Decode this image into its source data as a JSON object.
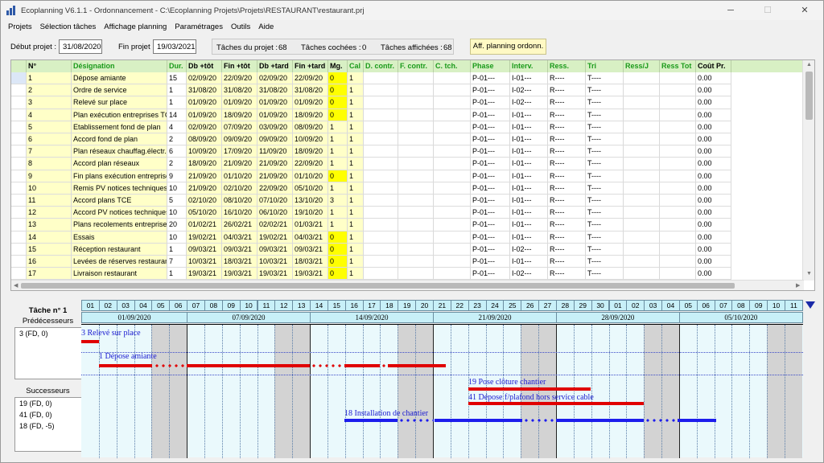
{
  "window": {
    "title": "Ecoplanning V6.1.1 - Ordonnancement - C:\\Ecoplanning Projets\\Projets\\RESTAURANT\\restaurant.prj",
    "minimize": "─",
    "maximize": "☐",
    "close": "✕"
  },
  "menu": [
    "Projets",
    "Sélection tâches",
    "Affichage planning",
    "Paramétrages",
    "Outils",
    "Aide"
  ],
  "info": {
    "debut_label": "Début projet :",
    "debut_value": "31/08/2020",
    "fin_label": "Fin projet :",
    "fin_value": "19/03/2021",
    "taches_projet_label": "Tâches du projet :",
    "taches_projet_value": "68",
    "taches_cochees_label": "Tâches cochées :",
    "taches_cochees_value": "0",
    "taches_affichees_label": "Tâches affichées :",
    "taches_affichees_value": "68",
    "planning_button": "Aff. planning ordonn."
  },
  "table": {
    "headers": [
      "N°",
      "Désignation",
      "Dur.",
      "Db +tôt",
      "Fin +tôt",
      "Db +tard",
      "Fin +tard",
      "Mg.",
      "Cal",
      "D. contr.",
      "F. contr.",
      "C. tch.",
      "Phase",
      "Interv.",
      "Ress.",
      "Tri",
      "Ress/J",
      "Ress Tot",
      "Coût Pr."
    ],
    "rows": [
      [
        "1",
        "Dépose amiante",
        "15",
        "02/09/20",
        "22/09/20",
        "02/09/20",
        "22/09/20",
        "0",
        "1",
        "",
        "",
        "",
        "P-01---",
        "I-01---",
        "R----",
        "T----",
        "",
        "",
        "0.00"
      ],
      [
        "2",
        "Ordre de service",
        "1",
        "31/08/20",
        "31/08/20",
        "31/08/20",
        "31/08/20",
        "0",
        "1",
        "",
        "",
        "",
        "P-01---",
        "I-02---",
        "R----",
        "T----",
        "",
        "",
        "0.00"
      ],
      [
        "3",
        "Relevé sur place",
        "1",
        "01/09/20",
        "01/09/20",
        "01/09/20",
        "01/09/20",
        "0",
        "1",
        "",
        "",
        "",
        "P-01---",
        "I-02---",
        "R----",
        "T----",
        "",
        "",
        "0.00"
      ],
      [
        "4",
        "Plan exécution entreprises TCE",
        "14",
        "01/09/20",
        "18/09/20",
        "01/09/20",
        "18/09/20",
        "0",
        "1",
        "",
        "",
        "",
        "P-01---",
        "I-01---",
        "R----",
        "T----",
        "",
        "",
        "0.00"
      ],
      [
        "5",
        "Etablissement fond de plan",
        "4",
        "02/09/20",
        "07/09/20",
        "03/09/20",
        "08/09/20",
        "1",
        "1",
        "",
        "",
        "",
        "P-01---",
        "I-01---",
        "R----",
        "T----",
        "",
        "",
        "0.00"
      ],
      [
        "6",
        "Accord fond de plan",
        "2",
        "08/09/20",
        "09/09/20",
        "09/09/20",
        "10/09/20",
        "1",
        "1",
        "",
        "",
        "",
        "P-01---",
        "I-01---",
        "R----",
        "T----",
        "",
        "",
        "0.00"
      ],
      [
        "7",
        "Plan réseaux chauffag.électr.plomb.",
        "6",
        "10/09/20",
        "17/09/20",
        "11/09/20",
        "18/09/20",
        "1",
        "1",
        "",
        "",
        "",
        "P-01---",
        "I-01---",
        "R----",
        "T----",
        "",
        "",
        "0.00"
      ],
      [
        "8",
        "Accord plan réseaux",
        "2",
        "18/09/20",
        "21/09/20",
        "21/09/20",
        "22/09/20",
        "1",
        "1",
        "",
        "",
        "",
        "P-01---",
        "I-01---",
        "R----",
        "T----",
        "",
        "",
        "0.00"
      ],
      [
        "9",
        "Fin plans exécution entreprises TCE",
        "9",
        "21/09/20",
        "01/10/20",
        "21/09/20",
        "01/10/20",
        "0",
        "1",
        "",
        "",
        "",
        "P-01---",
        "I-01---",
        "R----",
        "T----",
        "",
        "",
        "0.00"
      ],
      [
        "10",
        "Remis PV notices techniques",
        "10",
        "21/09/20",
        "02/10/20",
        "22/09/20",
        "05/10/20",
        "1",
        "1",
        "",
        "",
        "",
        "P-01---",
        "I-01---",
        "R----",
        "T----",
        "",
        "",
        "0.00"
      ],
      [
        "11",
        "Accord plans TCE",
        "5",
        "02/10/20",
        "08/10/20",
        "07/10/20",
        "13/10/20",
        "3",
        "1",
        "",
        "",
        "",
        "P-01---",
        "I-01---",
        "R----",
        "T----",
        "",
        "",
        "0.00"
      ],
      [
        "12",
        "Accord PV notices techniques",
        "10",
        "05/10/20",
        "16/10/20",
        "06/10/20",
        "19/10/20",
        "1",
        "1",
        "",
        "",
        "",
        "P-01---",
        "I-01---",
        "R----",
        "T----",
        "",
        "",
        "0.00"
      ],
      [
        "13",
        "Plans recolements entreprises TCE",
        "20",
        "01/02/21",
        "26/02/21",
        "02/02/21",
        "01/03/21",
        "1",
        "1",
        "",
        "",
        "",
        "P-01---",
        "I-01---",
        "R----",
        "T----",
        "",
        "",
        "0.00"
      ],
      [
        "14",
        "Essais",
        "10",
        "19/02/21",
        "04/03/21",
        "19/02/21",
        "04/03/21",
        "0",
        "1",
        "",
        "",
        "",
        "P-01---",
        "I-01---",
        "R----",
        "T----",
        "",
        "",
        "0.00"
      ],
      [
        "15",
        "Réception restaurant",
        "1",
        "09/03/21",
        "09/03/21",
        "09/03/21",
        "09/03/21",
        "0",
        "1",
        "",
        "",
        "",
        "P-01---",
        "I-02---",
        "R----",
        "T----",
        "",
        "",
        "0.00"
      ],
      [
        "16",
        "Levées de réserves restaurant",
        "7",
        "10/03/21",
        "18/03/21",
        "10/03/21",
        "18/03/21",
        "0",
        "1",
        "",
        "",
        "",
        "P-01---",
        "I-01---",
        "R----",
        "T----",
        "",
        "",
        "0.00"
      ],
      [
        "17",
        "Livraison restaurant",
        "1",
        "19/03/21",
        "19/03/21",
        "19/03/21",
        "19/03/21",
        "0",
        "1",
        "",
        "",
        "",
        "P-01---",
        "I-02---",
        "R----",
        "T----",
        "",
        "",
        "0.00"
      ]
    ]
  },
  "task_panel": {
    "title": "Tâche n° 1",
    "predecessors_label": "Prédécesseurs",
    "predecessors": [
      "3  (FD, 0)"
    ],
    "successors_label": "Successeurs",
    "successors": [
      "19  (FD, 0)",
      "41  (FD, 0)",
      "18  (FD, -5)"
    ]
  },
  "gantt": {
    "days": [
      "01",
      "02",
      "03",
      "04",
      "05",
      "06",
      "07",
      "08",
      "09",
      "10",
      "11",
      "12",
      "13",
      "14",
      "15",
      "16",
      "17",
      "18",
      "19",
      "20",
      "21",
      "22",
      "23",
      "24",
      "25",
      "26",
      "27",
      "28",
      "29",
      "30",
      "01",
      "02",
      "03",
      "04",
      "05",
      "06",
      "07",
      "08",
      "09",
      "10",
      "11"
    ],
    "weeks": [
      "01/09/2020",
      "07/09/2020",
      "14/09/2020",
      "21/09/2020",
      "28/09/2020",
      "05/10/2020"
    ],
    "tasks": [
      {
        "label": "3 Relevé sur place",
        "color": "#e00000"
      },
      {
        "label": "1 Dépose amiante",
        "color": "#e00000"
      },
      {
        "label": "19 Pose clôture chantier",
        "color": "#e00000"
      },
      {
        "label": "41 Dépose f/plafond hors service cable",
        "color": "#e00000"
      },
      {
        "label": "18 Installation de chantier",
        "color": "#1d1ded"
      }
    ]
  }
}
